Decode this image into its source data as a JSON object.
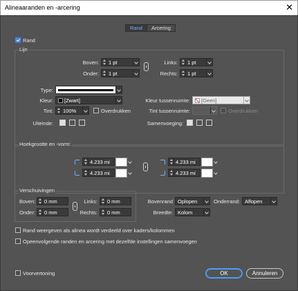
{
  "window": {
    "title": "Alineaaranden en -arcering",
    "close_glyph": "✕"
  },
  "tabs": [
    {
      "label": "Rand",
      "active": true
    },
    {
      "label": "Arcering",
      "active": false
    }
  ],
  "rand_checkbox": {
    "label": "Rand",
    "checked": true
  },
  "lijn": {
    "legend": "Lijn",
    "boven_label": "Boven:",
    "boven_value": "1 pt",
    "onder_label": "Onder:",
    "onder_value": "1 pt",
    "links_label": "Links:",
    "links_value": "1 pt",
    "rechts_label": "Rechts:",
    "rechts_value": "1 pt",
    "type_label": "Type:",
    "kleur_label": "Kleur:",
    "kleur_value": "[Zwart]",
    "kleur_tussenruimte_label": "Kleur tussenruimte:",
    "kleur_tussenruimte_value": "[Geen]",
    "tint_label": "Tint:",
    "tint_value": "100%",
    "overdrukken_label": "Overdrukken",
    "tint_tussenruimte_label": "Tint tussenruimte:",
    "tint_tussenruimte_value": "",
    "overdrukken2_label": "Overdrukken",
    "uiteinde_label": "Uiteinde:",
    "samenvoeging_label": "Samenvoeging:"
  },
  "hoek": {
    "legend": "Hoekgrootte en -vorm:",
    "tl_value": "4.233 mi",
    "bl_value": "4.233 mi",
    "tr_value": "4.233 mi",
    "br_value": "4.233 mi"
  },
  "verschuivingen": {
    "legend": "Verschuivingen",
    "boven_label": "Boven:",
    "boven_value": "0 mm",
    "onder_label": "Onder:",
    "onder_value": "0 mm",
    "links_label": "Links:",
    "links_value": "0 mm",
    "rechts_label": "Rechts:",
    "rechts_value": "0 mm"
  },
  "bovenrand": {
    "label": "Bovenrand",
    "value": "Oplopen"
  },
  "onderrand": {
    "label": "Onderrand:",
    "value": "Aflopen"
  },
  "breedte": {
    "label": "Breedte:",
    "value": "Kolom"
  },
  "option1": {
    "label": "Rand weergeven als alinea wordt verdeeld over kaders/kolommen",
    "checked": false
  },
  "option2": {
    "label": "Opeenvolgende randen en arcering met dezelfde instellingen samenvoegen",
    "checked": false
  },
  "preview": {
    "label": "Voorvertoning",
    "checked": false
  },
  "buttons": {
    "ok": "OK",
    "cancel": "Annuleren"
  },
  "colors": {
    "dialog_bg": "#535353",
    "accent": "#4b9cff",
    "tab_active_text": "#6cb0ff"
  }
}
